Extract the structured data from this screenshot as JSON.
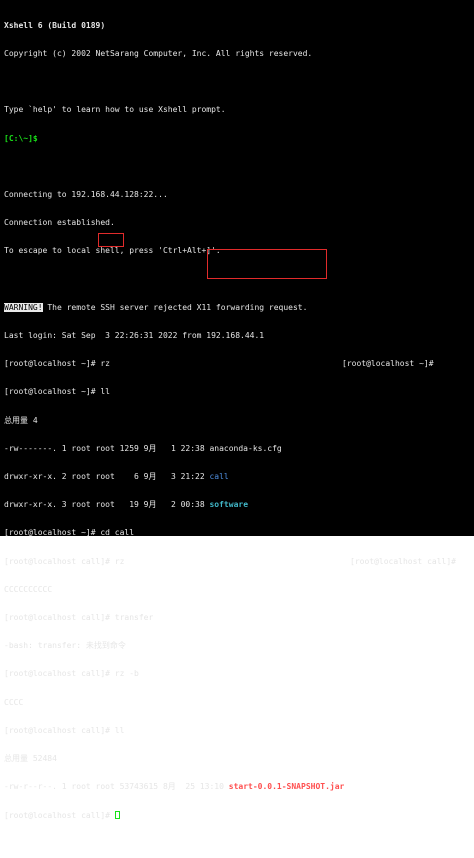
{
  "terminal": {
    "header_title": "Xshell 6 (Build 0189)",
    "copyright": "Copyright (c) 2002 NetSarang Computer, Inc. All rights reserved.",
    "help_hint": "Type `help' to learn how to use Xshell prompt.",
    "local_prompt": "[C:\\~]$",
    "connecting": "Connecting to 192.168.44.128:22...",
    "established": "Connection established.",
    "escape_hint": "To escape to local shell, press 'Ctrl+Alt+]'.",
    "warning_label": "WARNING!",
    "warning_text": " The remote SSH server rejected X11 forwarding request.",
    "last_login": "Last login: Sat Sep  3 22:26:31 2022 from 192.168.44.1",
    "cmd_rz_1": "[root@localhost ~]# rz",
    "right_prompt_1": "[root@localhost ~]#",
    "cmd_ll_1": "[root@localhost ~]# ll",
    "total_1": "总用量 4",
    "ls1_row1": "-rw-------. 1 root root 1259 9月   1 22:38 anaconda-ks.cfg",
    "ls1_row2_meta": "drwxr-xr-x. 2 root root    6 9月   3 21:22 ",
    "ls1_row2_name": "call",
    "ls1_row3_meta": "drwxr-xr-x. 3 root root   19 9月   2 00:38 ",
    "ls1_row3_name": "software",
    "cmd_cd": "[root@localhost ~]# cd call",
    "cmd_rz_2": "[root@localhost call]# rz",
    "right_prompt_2": "[root@localhost call]#",
    "rz_output": "CCCCCCCCCC",
    "cmd_transfer": "[root@localhost call]# transfer",
    "transfer_error": "-bash: transfer: 未找到命令",
    "cmd_rz_b": "[root@localhost call]# rz -b",
    "rz_b_output": "CCCC",
    "ll_prompt": "[root@localhost call]#",
    "ll_cmd": " ll",
    "total_2": "总用量 52484",
    "ls2_meta": "-rw-r--r--. 1 root root 53743615 8月  25 13:10 ",
    "ls2_name": "start-0.0.1-SNAPSHOT.jar",
    "final_prompt": "[root@localhost call]# "
  },
  "colors": {
    "background": "#000000",
    "text": "#e6e6e6",
    "prompt_green": "#19e219",
    "directory_blue": "#4f8fe0",
    "directory_cyan": "#41b8c9",
    "jar_red": "#ff4e4e",
    "annotation_box": "#e12b2b"
  }
}
